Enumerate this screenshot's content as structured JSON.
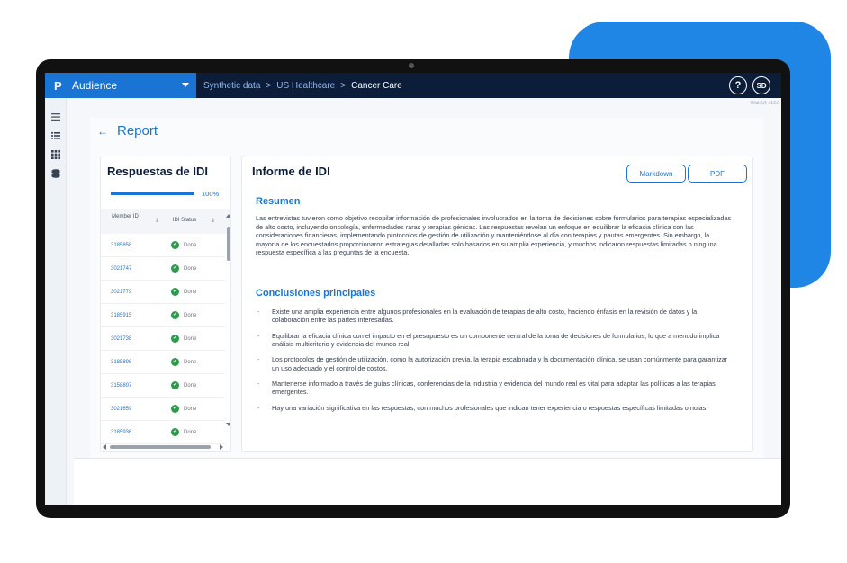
{
  "app": {
    "brand_logo": "P",
    "brand_name": "Audience",
    "version": "Wick UI: v13.0",
    "accent_color": "#1a74d4",
    "decor_color": "#1f86e6"
  },
  "breadcrumb": {
    "items": [
      "Synthetic data",
      "US Healthcare",
      "Cancer Care"
    ],
    "separator": ">"
  },
  "header": {
    "help_label": "?",
    "avatar_initials": "SD"
  },
  "sidebar": {
    "items": [
      {
        "icon": "menu-icon"
      },
      {
        "icon": "list-icon"
      },
      {
        "icon": "grid-icon"
      },
      {
        "icon": "database-icon"
      }
    ]
  },
  "page": {
    "back_arrow": "←",
    "title": "Report"
  },
  "responses": {
    "title": "Respuestas de IDI",
    "progress_percent": 100,
    "progress_label": "100%",
    "columns": [
      "Member ID",
      "IDI Status"
    ],
    "rows": [
      {
        "id": "3185858",
        "status": "Done"
      },
      {
        "id": "3021747",
        "status": "Done"
      },
      {
        "id": "3021779",
        "status": "Done"
      },
      {
        "id": "3185915",
        "status": "Done"
      },
      {
        "id": "3021738",
        "status": "Done"
      },
      {
        "id": "3185898",
        "status": "Done"
      },
      {
        "id": "3158807",
        "status": "Done"
      },
      {
        "id": "3021659",
        "status": "Done"
      },
      {
        "id": "3185936",
        "status": "Done"
      }
    ]
  },
  "report": {
    "title": "Informe de IDI",
    "buttons": {
      "markdown": "Markdown",
      "pdf": "PDF"
    },
    "summary_title": "Resumen",
    "summary_text": "Las entrevistas tuvieron como objetivo recopilar información de profesionales involucrados en la toma de decisiones sobre formularios para terapias especializadas de alto costo, incluyendo oncología, enfermedades raras y terapias génicas. Las respuestas revelan un enfoque en equilibrar la eficacia clínica con las consideraciones financieras, implementando protocolos de gestión de utilización y manteniéndose al día con terapias y pautas emergentes. Sin embargo, la mayoría de los encuestados proporcionaron estrategias detalladas solo basados en su amplia experiencia, y muchos indicaron respuestas limitadas o ninguna respuesta específica a las preguntas de la encuesta.",
    "conclusions_title": "Conclusiones principales",
    "bullet_marker": "-",
    "conclusions": [
      "Existe una amplia experiencia entre algunos profesionales en la evaluación de terapias de alto costo, haciendo énfasis en la revisión de datos y la colaboración entre las partes interesadas.",
      "Equilibrar la eficacia clínica con el impacto en el presupuesto es un componente central de la toma de decisiones de formularios, lo que a menudo implica análisis multicriterio y evidencia del mundo real.",
      "Los protocolos de gestión de utilización, como la autorización previa, la terapia escalonada y la documentación clínica, se usan comúnmente para garantizar un uso adecuado y el control de costos.",
      "Mantenerse informado a través de guías clínicas, conferencias de la industria y evidencia del mundo real es vital para adaptar las políticas a las terapias emergentes.",
      "Hay una variación significativa en las respuestas, con muchos profesionales que indican tener experiencia o respuestas específicas limitadas o nulas."
    ]
  }
}
